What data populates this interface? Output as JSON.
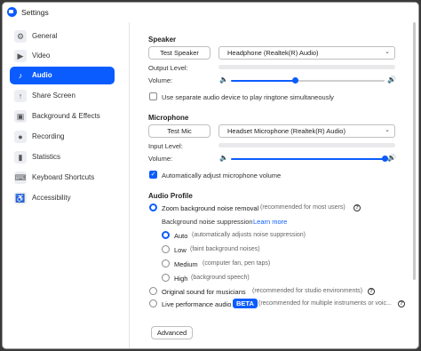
{
  "window": {
    "title": "Settings"
  },
  "colors": {
    "accent": "#0b5cff"
  },
  "sidebar": {
    "items": [
      {
        "label": "General",
        "icon": "gear-icon",
        "glyph": "⚙",
        "active": false
      },
      {
        "label": "Video",
        "icon": "video-icon",
        "glyph": "▶",
        "active": false
      },
      {
        "label": "Audio",
        "icon": "headphone-icon",
        "glyph": "♪",
        "active": true
      },
      {
        "label": "Share Screen",
        "icon": "share-screen-icon",
        "glyph": "↑",
        "active": false
      },
      {
        "label": "Background & Effects",
        "icon": "background-effects-icon",
        "glyph": "▣",
        "active": false
      },
      {
        "label": "Recording",
        "icon": "recording-icon",
        "glyph": "●",
        "active": false
      },
      {
        "label": "Statistics",
        "icon": "statistics-icon",
        "glyph": "▮",
        "active": false
      },
      {
        "label": "Keyboard Shortcuts",
        "icon": "keyboard-icon",
        "glyph": "⌨",
        "active": false
      },
      {
        "label": "Accessibility",
        "icon": "accessibility-icon",
        "glyph": "♿",
        "active": false
      }
    ]
  },
  "speaker": {
    "title": "Speaker",
    "test_button": "Test Speaker",
    "device": "Headphone (Realtek(R) Audio)",
    "output_level_label": "Output Level:",
    "volume_label": "Volume:",
    "volume": 0.42,
    "separate_device_label": "Use separate audio device to play ringtone simultaneously",
    "separate_device_checked": false
  },
  "microphone": {
    "title": "Microphone",
    "test_button": "Test Mic",
    "device": "Headset Microphone (Realtek(R) Audio)",
    "input_level_label": "Input Level:",
    "volume_label": "Volume:",
    "volume": 1.0,
    "auto_adjust_label": "Automatically adjust microphone volume",
    "auto_adjust_checked": true
  },
  "audio_profile": {
    "title": "Audio Profile",
    "zoom_noise_removal": {
      "label": "Zoom background noise removal",
      "hint": "(recommended for most users)",
      "selected": true
    },
    "suppression_label": "Background noise suppression",
    "learn_more": "Learn more",
    "levels": [
      {
        "label": "Auto",
        "hint": "(automatically adjusts noise suppression)",
        "selected": true
      },
      {
        "label": "Low",
        "hint": "(faint background noises)",
        "selected": false
      },
      {
        "label": "Medium",
        "hint": "(computer fan, pen taps)",
        "selected": false
      },
      {
        "label": "High",
        "hint": "(background speech)",
        "selected": false
      }
    ],
    "original_sound": {
      "label": "Original sound for musicians",
      "hint": "(recommended for studio environments)",
      "selected": false
    },
    "live_performance": {
      "label": "Live performance audio",
      "badge": "BETA",
      "hint": "(recommended for multiple instruments or voic...",
      "selected": false
    }
  },
  "advanced_button": "Advanced"
}
